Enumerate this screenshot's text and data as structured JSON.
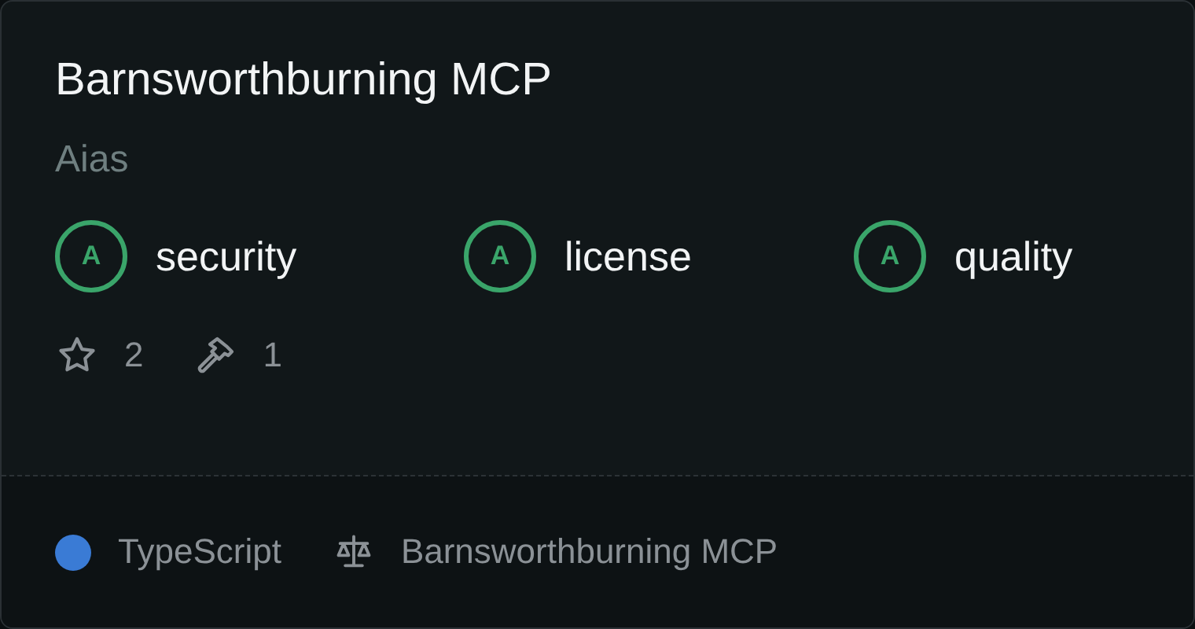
{
  "card": {
    "title": "Barnsworthburning MCP",
    "subtitle": "Aias",
    "scores": [
      {
        "grade": "A",
        "label": "security"
      },
      {
        "grade": "A",
        "label": "license"
      },
      {
        "grade": "A",
        "label": "quality"
      }
    ],
    "stars": "2",
    "tools": "1",
    "language": {
      "name": "TypeScript",
      "color": "#3a7bd5"
    },
    "license": "Barnsworthburning MCP"
  }
}
